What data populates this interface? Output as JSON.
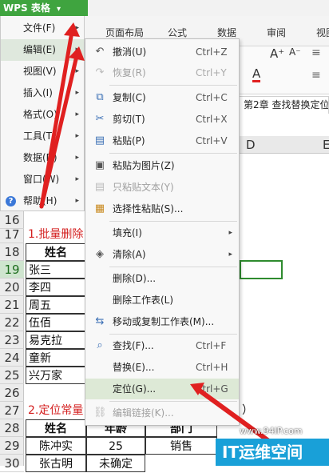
{
  "app": {
    "title": "WPS 表格",
    "title_arrow": "▾"
  },
  "ribbon": {
    "tabs": [
      "页面布局",
      "公式",
      "数据",
      "审阅",
      "视图"
    ]
  },
  "toolbar": {
    "font_grow": "A⁺",
    "font_shrink": "A⁻",
    "font_color": "A"
  },
  "doc_tab": {
    "label": "第2章 查找替换定位"
  },
  "columns": [
    "D",
    "E"
  ],
  "main_menu": {
    "items": [
      {
        "label": "文件(F)",
        "arrow": "▸"
      },
      {
        "label": "编辑(E)",
        "arrow": "▸"
      },
      {
        "label": "视图(V)",
        "arrow": "▸"
      },
      {
        "label": "插入(I)",
        "arrow": "▸"
      },
      {
        "label": "格式(O)",
        "arrow": "▸"
      },
      {
        "label": "工具(T)",
        "arrow": "▸"
      },
      {
        "label": "数据(D)",
        "arrow": "▸"
      },
      {
        "label": "窗口(W)",
        "arrow": "▸"
      },
      {
        "label": "帮助(H)",
        "arrow": "▸"
      }
    ],
    "help_icon": "?"
  },
  "edit_menu": {
    "items": [
      {
        "label": "撤消(U)",
        "shortcut": "Ctrl+Z",
        "icon": "undo-icon",
        "glyph": "↶"
      },
      {
        "label": "恢复(R)",
        "shortcut": "Ctrl+Y",
        "icon": "redo-icon",
        "glyph": "↷"
      },
      {
        "label": "复制(C)",
        "shortcut": "Ctrl+C",
        "icon": "copy-icon",
        "glyph": "⧉"
      },
      {
        "label": "剪切(T)",
        "shortcut": "Ctrl+X",
        "icon": "scissors-icon",
        "glyph": "✂"
      },
      {
        "label": "粘贴(P)",
        "shortcut": "Ctrl+V",
        "icon": "paste-icon",
        "glyph": "📋"
      },
      {
        "label": "粘贴为图片(Z)",
        "shortcut": "",
        "icon": "paste-image-icon",
        "glyph": "▣"
      },
      {
        "label": "只粘贴文本(Y)",
        "shortcut": "",
        "icon": "paste-text-icon",
        "glyph": "▤"
      },
      {
        "label": "选择性粘贴(S)...",
        "shortcut": "",
        "icon": "paste-special-icon",
        "glyph": "▦"
      },
      {
        "label": "填充(I)",
        "shortcut": "",
        "submenu": "▸"
      },
      {
        "label": "清除(A)",
        "shortcut": "",
        "icon": "eraser-icon",
        "glyph": "◈",
        "submenu": "▸"
      },
      {
        "label": "删除(D)...",
        "shortcut": ""
      },
      {
        "label": "删除工作表(L)",
        "shortcut": ""
      },
      {
        "label": "移动或复制工作表(M)...",
        "shortcut": "",
        "icon": "move-sheet-icon",
        "glyph": "⇆"
      },
      {
        "label": "查找(F)...",
        "shortcut": "Ctrl+F",
        "icon": "find-icon",
        "glyph": "⌕"
      },
      {
        "label": "替换(E)...",
        "shortcut": "Ctrl+H"
      },
      {
        "label": "定位(G)...",
        "shortcut": "Ctrl+G"
      },
      {
        "label": "编辑链接(K)...",
        "shortcut": "",
        "icon": "link-icon",
        "glyph": "⛓"
      }
    ]
  },
  "sheet": {
    "row_numbers": [
      "16",
      "17",
      "18",
      "19",
      "20",
      "21",
      "22",
      "23",
      "24",
      "25",
      "26",
      "27",
      "28",
      "29",
      "30"
    ],
    "title1": "1.批量删除",
    "header_name": "姓名",
    "names": [
      "张三",
      "李四",
      "周五",
      "伍佰",
      "易克拉",
      "童新",
      "兴万家"
    ],
    "title2": "2.定位常量",
    "title2_tail": "）",
    "table2_headers": [
      "姓名",
      "年龄",
      "部门"
    ],
    "row29": [
      "陈冲实",
      "25",
      "销售"
    ],
    "row30": [
      "张古明",
      "未确定",
      ""
    ]
  },
  "watermark": {
    "url": "www.94IP.com",
    "logo": "IT运维空间"
  }
}
